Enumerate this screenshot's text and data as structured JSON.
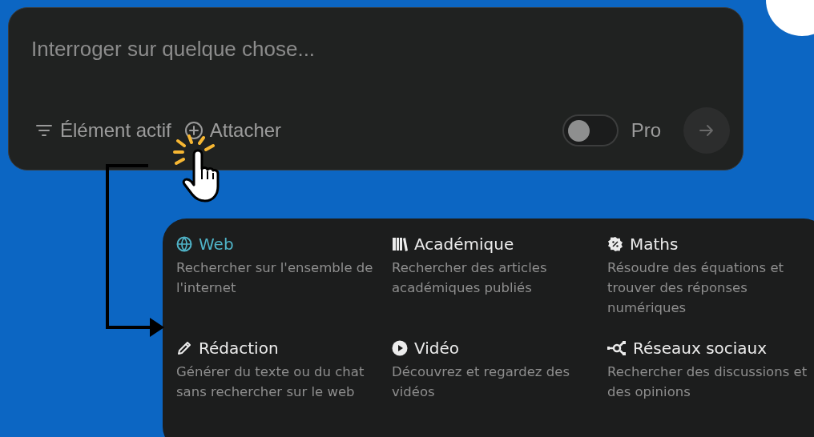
{
  "prompt": {
    "placeholder": "Interroger sur quelque chose..."
  },
  "toolbar": {
    "focus_label": "Élément actif",
    "attach_label": "Attacher",
    "pro_label": "Pro",
    "pro_toggle": {
      "on": false
    },
    "send_button": {
      "disabled": true
    }
  },
  "sources": [
    {
      "kind": "web",
      "title": "Web",
      "description": "Rechercher sur l'ensemble de l'internet",
      "selected": true
    },
    {
      "kind": "academic",
      "title": "Académique",
      "description": "Rechercher des articles académiques publiés",
      "selected": false
    },
    {
      "kind": "math",
      "title": "Maths",
      "description": "Résoudre des équations et trouver des réponses numériques",
      "selected": false
    },
    {
      "kind": "writing",
      "title": "Rédaction",
      "description": "Générer du texte ou du chat sans rechercher sur le web",
      "selected": false
    },
    {
      "kind": "video",
      "title": "Vidéo",
      "description": "Découvrez et regardez des vidéos",
      "selected": false
    },
    {
      "kind": "social",
      "title": "Réseaux sociaux",
      "description": "Rechercher des discussions et des opinions",
      "selected": false
    }
  ]
}
